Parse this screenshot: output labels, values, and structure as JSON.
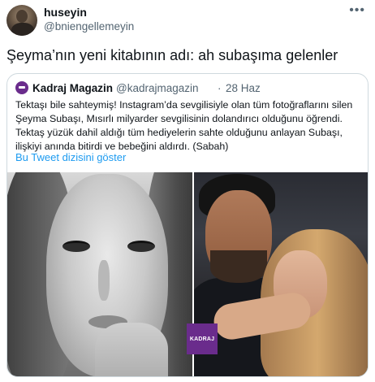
{
  "author": {
    "name": "huseyin",
    "handle": "@bniengellemeyin"
  },
  "more_icon": "more-horizontal-icon",
  "tweet_text": "Şeyma’nın yeni kitabının adı: ah subaşıma gelenler",
  "quoted_tweet": {
    "name": "Kadraj Magazin",
    "handle": "@kadrajmagazin",
    "separator": "·",
    "date": "28 Haz",
    "body_lines": [
      "Tektaşı bile sahteymiş! Instagram’da sevgilisiyle olan tüm fotoğraflarını silen",
      "Şeyma Subaşı, Mısırlı milyarder sevgilisinin dolandırıcı olduğunu öğrendi.",
      "Tektaş yüzük dahil aldığı tüm hediyelerin sahte olduğunu anlayan Subaşı,",
      "ilişkiyi anında bitirdi ve bebeğini aldırdı. (Sabah)"
    ],
    "thread_link": "Bu Tweet dizisini göster",
    "watermark": "KADRAJ"
  },
  "colors": {
    "text": "#0f1419",
    "secondary": "#536471",
    "link": "#1d9bf0",
    "border": "#cfd9de",
    "brand": "#6a2c8c"
  }
}
